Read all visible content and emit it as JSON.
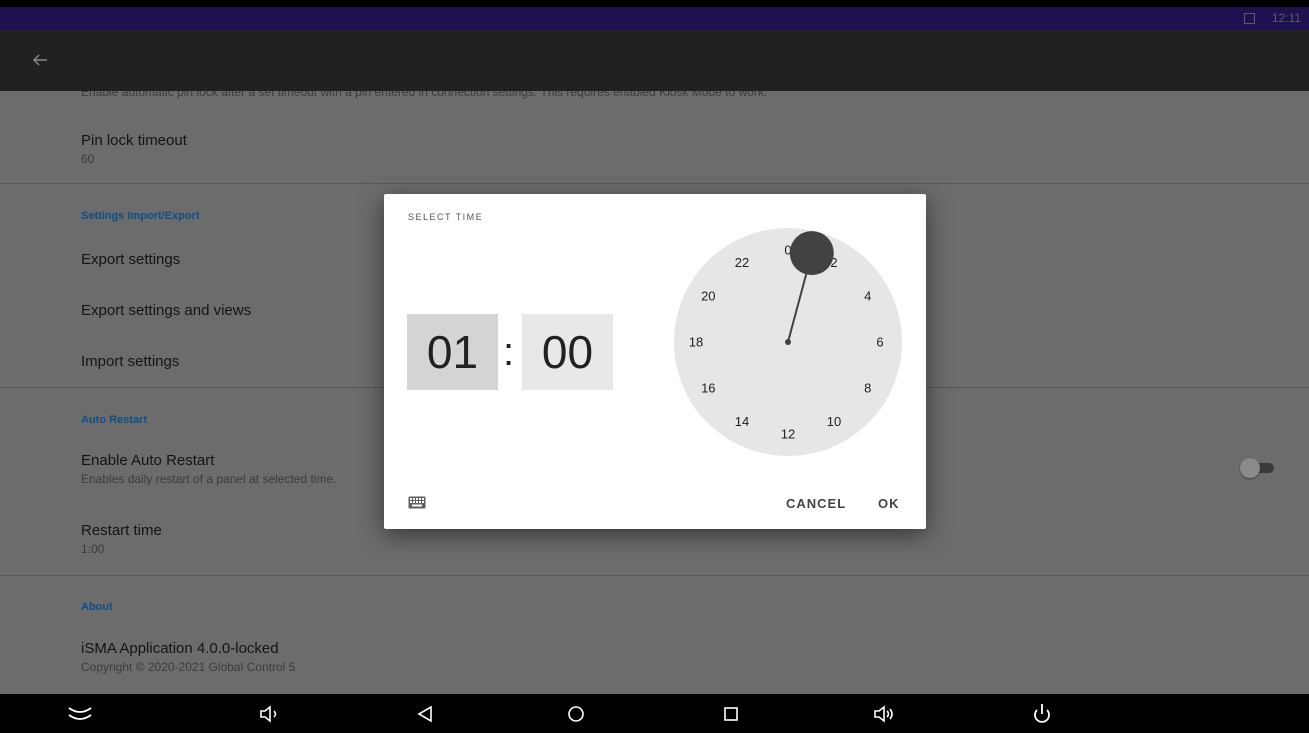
{
  "status_bar": {
    "time": "12:11"
  },
  "settings": {
    "cut_text": "Enable automatic pin lock after a set timeout with a pin entered in connection settings. This requires enabled Kiosk Mode to work.",
    "pin_lock": {
      "title": "Pin lock timeout",
      "value": "60"
    },
    "import_export": {
      "category": "Settings Import/Export",
      "items": [
        "Export settings",
        "Export settings and views",
        "Import settings"
      ]
    },
    "auto_restart": {
      "category": "Auto Restart",
      "enable": {
        "title": "Enable Auto Restart",
        "summary": "Enables daily restart of a panel at selected time.",
        "enabled": false
      },
      "restart_time": {
        "title": "Restart time",
        "value": "1:00"
      }
    },
    "about": {
      "category": "About",
      "app": {
        "title": "iSMA Application 4.0.0-locked",
        "copyright": "Copyright © 2020-2021 Global Control 5"
      }
    }
  },
  "dialog": {
    "title": "SELECT TIME",
    "hour": "01",
    "separator": ":",
    "minute": "00",
    "cancel_label": "CANCEL",
    "ok_label": "OK",
    "selected_hour": 1,
    "clock_labels": [
      "0",
      "2",
      "4",
      "6",
      "8",
      "10",
      "12",
      "14",
      "16",
      "18",
      "20",
      "22"
    ]
  },
  "colors": {
    "accent": "#0e4f8a",
    "status_bar": "#1f1150",
    "app_bar": "#212121",
    "scrim_bg": "#6c6c6c"
  },
  "nav_bar": {
    "icons": [
      "chevron-collapse-icon",
      "volume-down-icon",
      "back-icon",
      "home-icon",
      "recents-icon",
      "volume-up-icon",
      "power-icon"
    ]
  }
}
